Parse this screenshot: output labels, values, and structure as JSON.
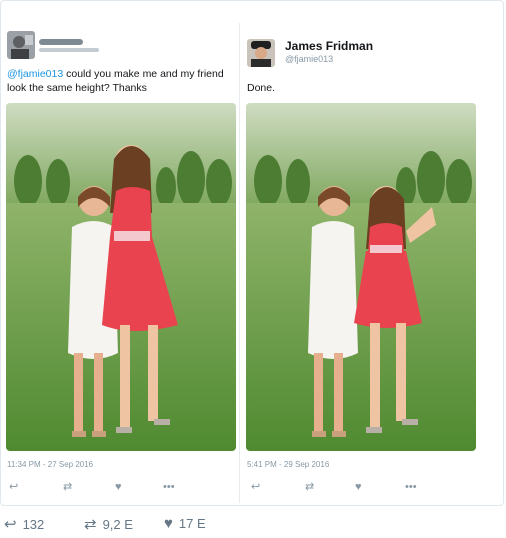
{
  "left_tweet": {
    "text_mention": "@fjamie013",
    "text_body": " could you make me and my friend look the same height? Thanks",
    "timestamp": "11:34 PM - 27 Sep 2016",
    "actions": {
      "reply_icon": "reply-icon",
      "retweet_icon": "retweet-icon",
      "like_icon": "heart-icon",
      "more_label": "•••"
    }
  },
  "right_tweet": {
    "author_name": "James Fridman",
    "author_handle": "@fjamie013",
    "text": "Done.",
    "timestamp": "5:41 PM - 29 Sep 2016",
    "actions": {
      "reply_icon": "reply-icon",
      "retweet_icon": "retweet-icon",
      "like_icon": "heart-icon",
      "more_label": "•••"
    }
  },
  "footer": {
    "reply_count": "132",
    "retweet_count": "9,2 E",
    "like_count": "17 E"
  },
  "colors": {
    "mention": "#1b95e0",
    "muted": "#8899a6",
    "dress": "#e8434f",
    "grass": "#5e9a3c"
  }
}
